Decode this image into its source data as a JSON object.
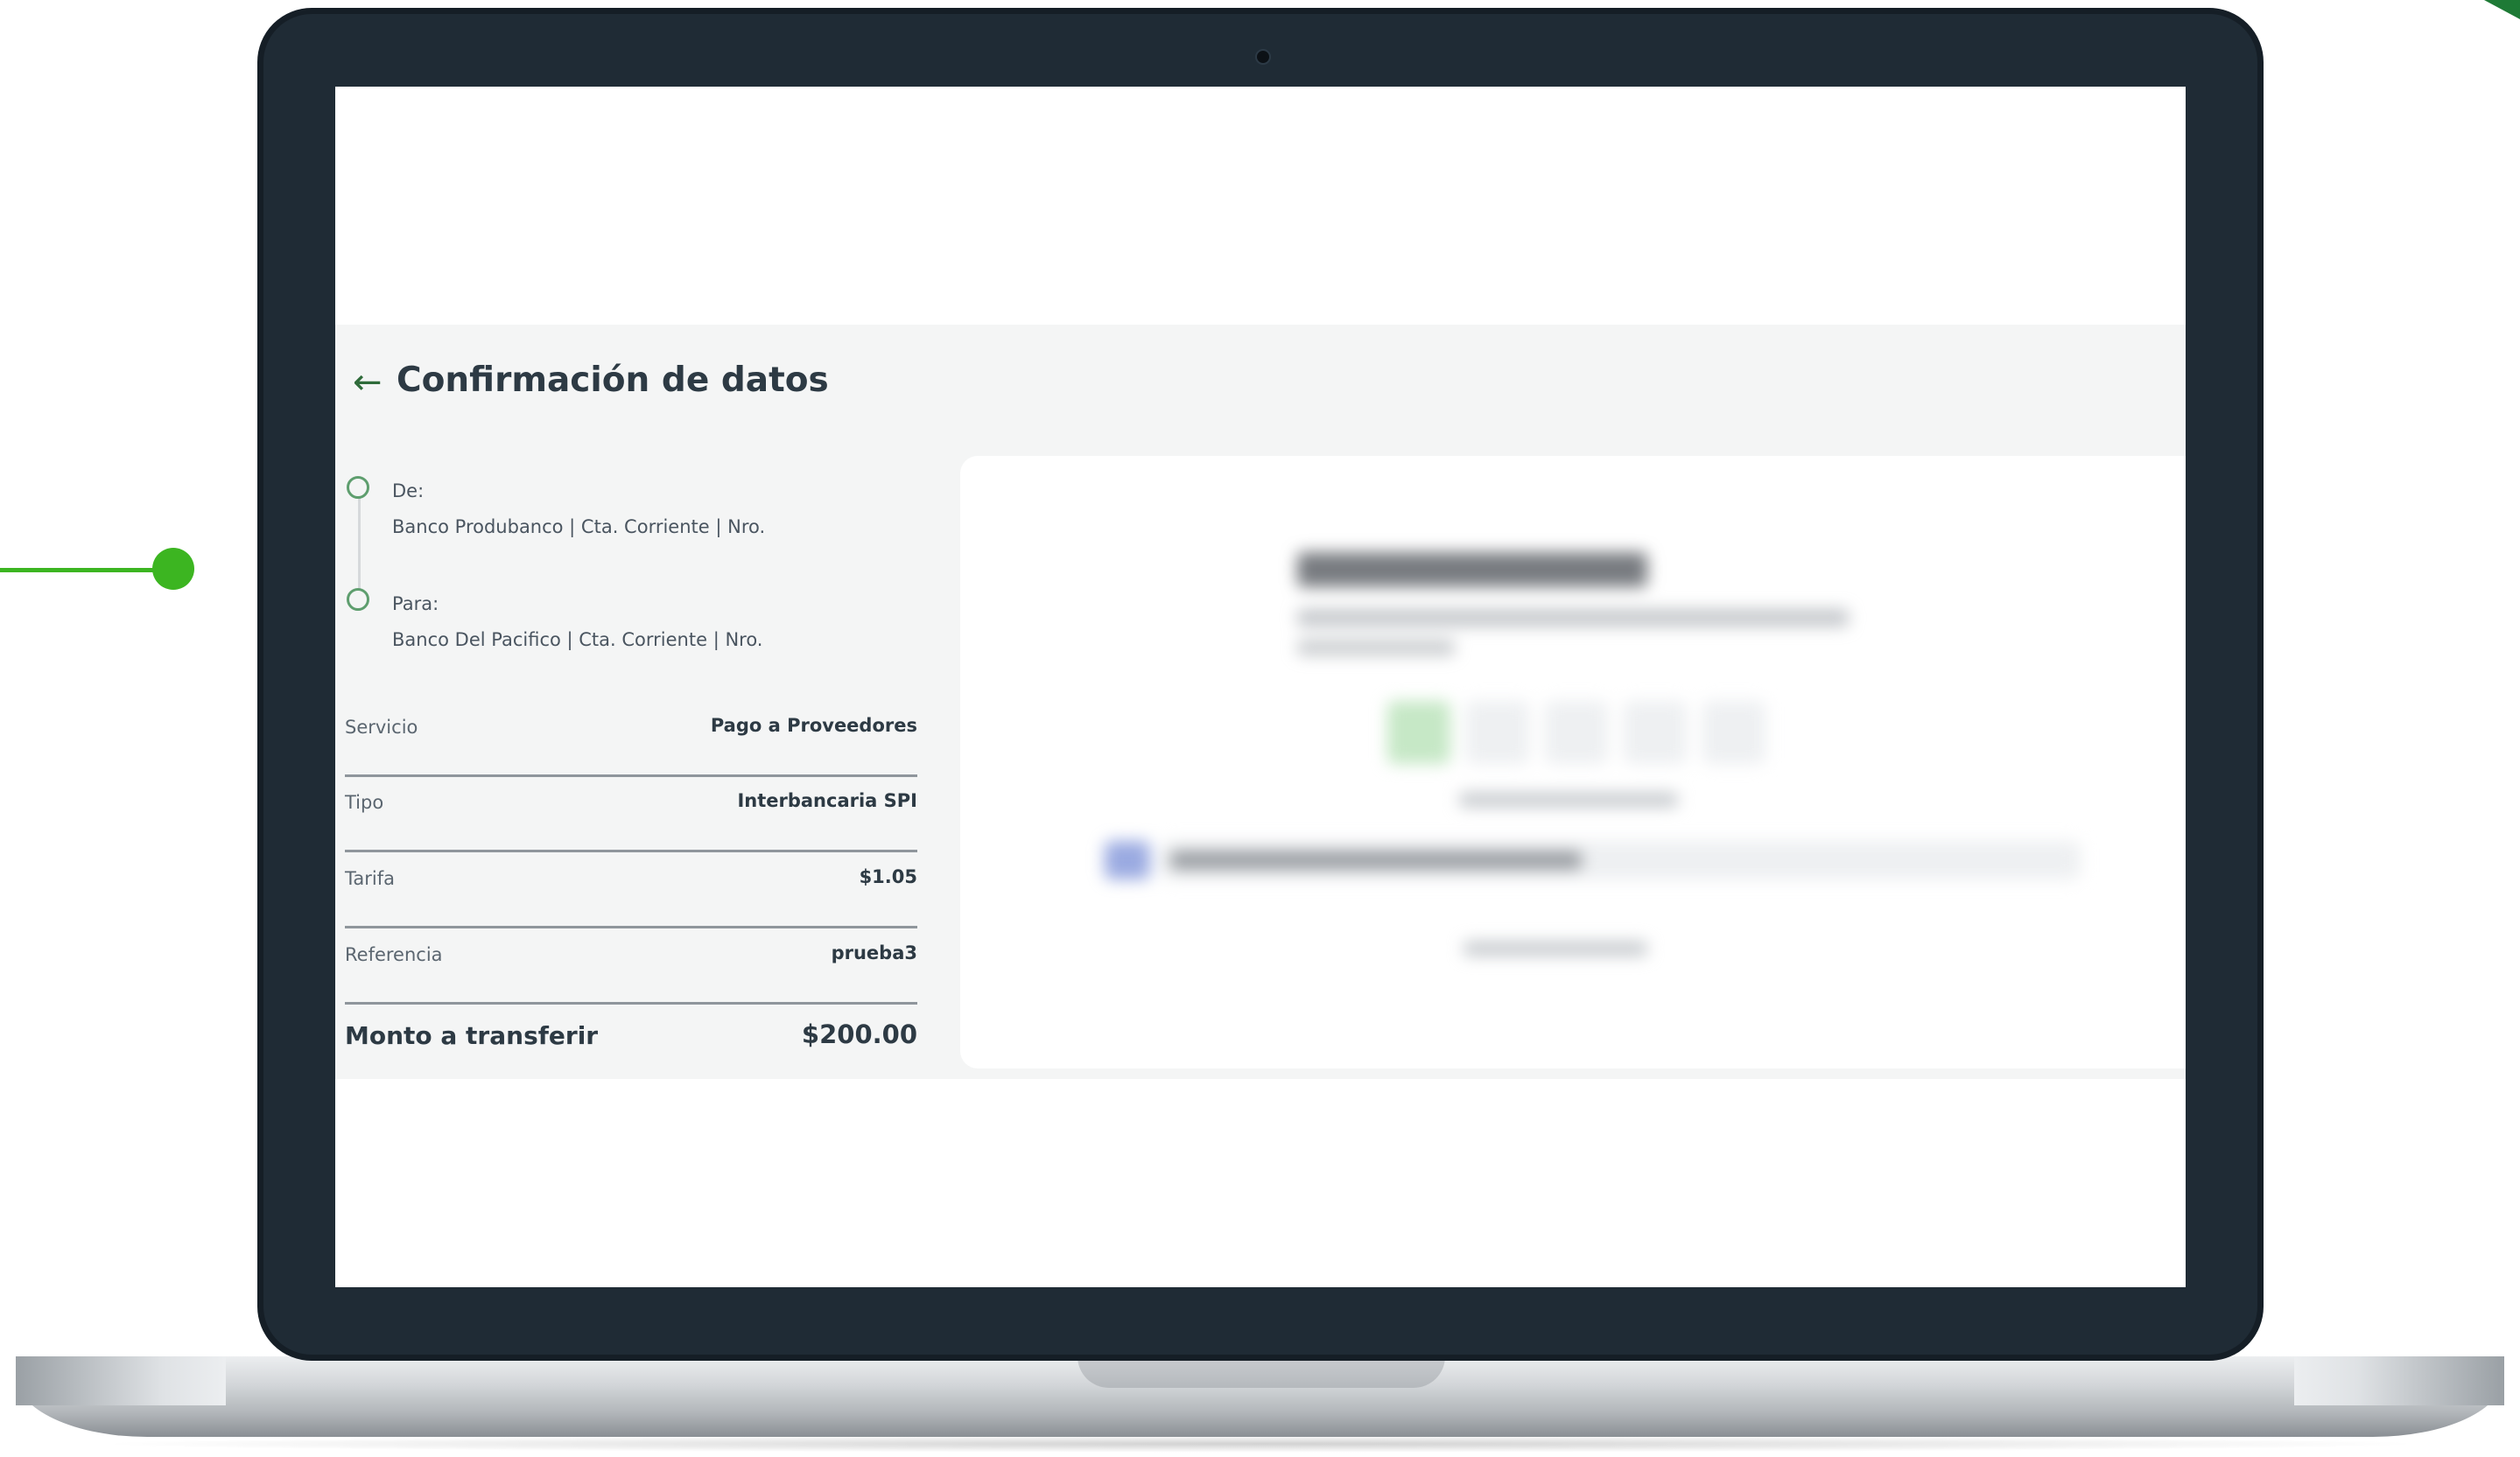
{
  "app": {
    "page_title": "Confirmación de datos"
  },
  "transfer": {
    "from_label": "De:",
    "from_detail": "Banco Produbanco | Cta. Corriente | Nro.",
    "to_label": "Para:",
    "to_detail": "Banco Del Pacifico | Cta. Corriente | Nro."
  },
  "details": [
    {
      "label": "Servicio",
      "value": "Pago a Proveedores"
    },
    {
      "label": "Tipo",
      "value": "Interbancaria SPI"
    },
    {
      "label": "Tarifa",
      "value": "$1.05"
    },
    {
      "label": "Referencia",
      "value": "prueba3"
    }
  ],
  "total": {
    "label": "Monto a transferir",
    "value": "$200.00"
  },
  "icons": {
    "back": "arrow-left-icon",
    "step": "circle-outline-icon"
  },
  "colors": {
    "accent_green": "#3cb521",
    "laptop_bezel": "#1f2b35",
    "text_dark": "#2d3a44",
    "panel_bg": "#f4f5f5"
  }
}
